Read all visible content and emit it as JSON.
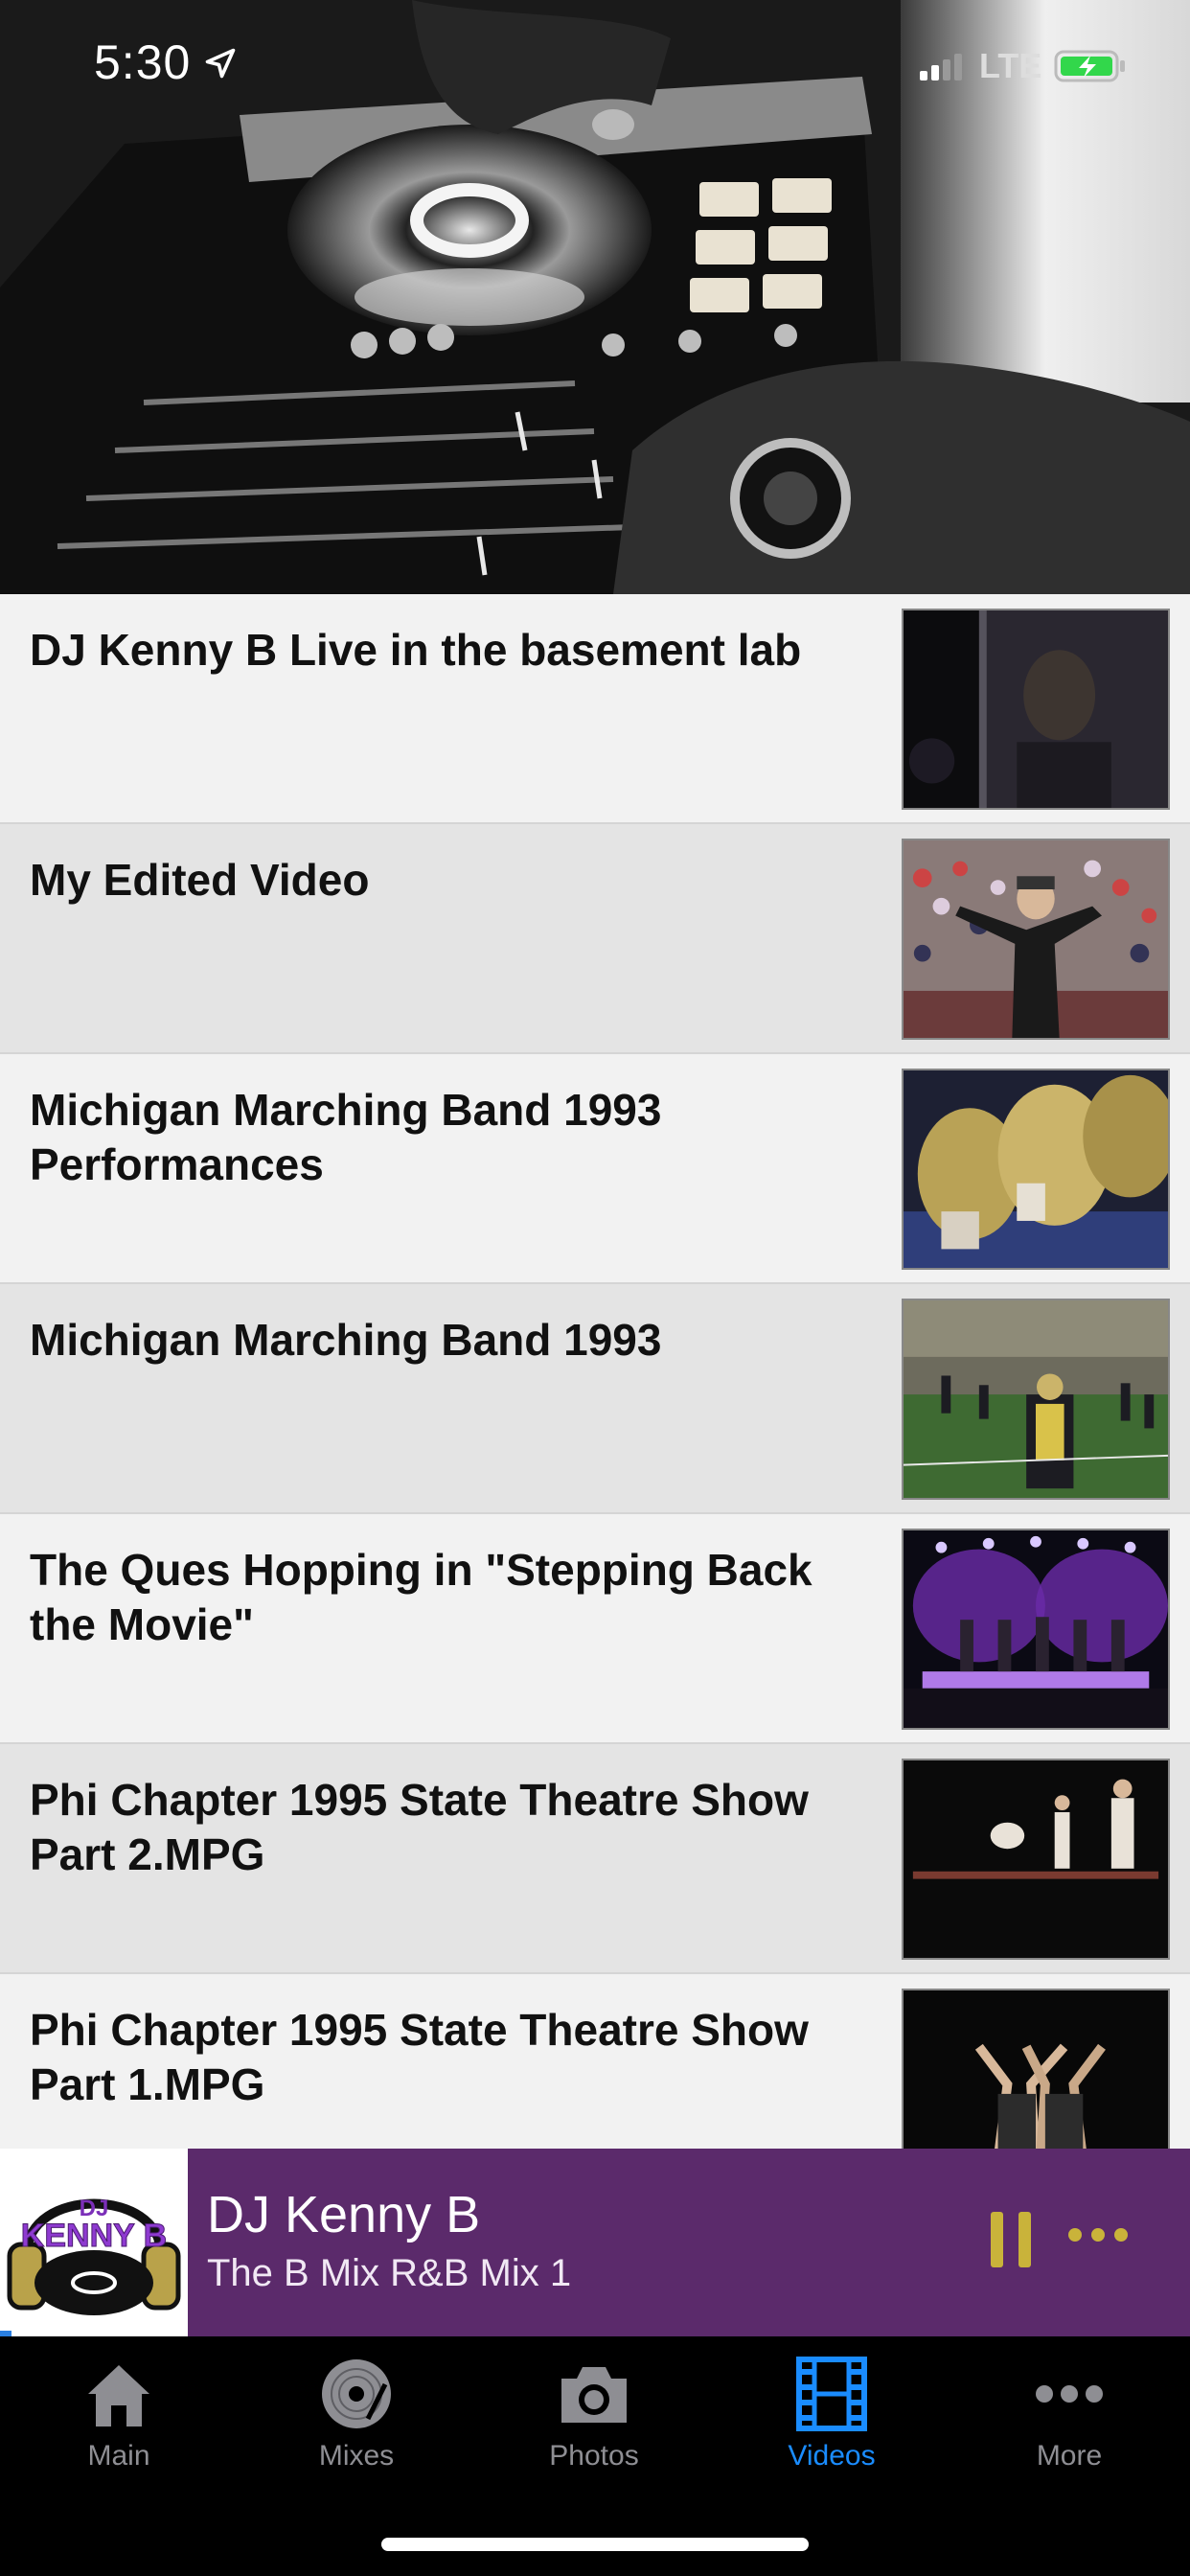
{
  "status_bar": {
    "time": "5:30",
    "network": "LTE",
    "battery_color": "#32d74b"
  },
  "hero": {
    "image": "dj-turntable-controller-photo"
  },
  "videos": [
    {
      "title": "DJ Kenny B Live in the basement lab",
      "thumb": "dark-portrait-webcam"
    },
    {
      "title": "My Edited Video",
      "thumb": "man-in-crowd-stadium"
    },
    {
      "title": "Michigan Marching Band 1993 Performances",
      "thumb": "cymbals-players"
    },
    {
      "title": "Michigan Marching Band 1993",
      "thumb": "band-on-field"
    },
    {
      "title": "The Ques Hopping in \"Stepping Back the Movie\"",
      "thumb": "purple-stage-steppers"
    },
    {
      "title": "Phi Chapter 1995 State Theatre Show Part 2.MPG",
      "thumb": "dark-stage-dancers"
    },
    {
      "title": "Phi Chapter 1995 State Theatre Show Part 1.MPG",
      "thumb": "dark-stage-arms-raised"
    }
  ],
  "player": {
    "artwork_logo": "DJ KENNY B",
    "artist": "DJ Kenny B",
    "track": "The B Mix R&B Mix 1",
    "accent_color": "#5b2a6b",
    "control_color": "#c9b33a"
  },
  "tabs": [
    {
      "label": "Main",
      "icon": "home-icon",
      "active": false
    },
    {
      "label": "Mixes",
      "icon": "vinyl-record-icon",
      "active": false
    },
    {
      "label": "Photos",
      "icon": "camera-icon",
      "active": false
    },
    {
      "label": "Videos",
      "icon": "film-strip-icon",
      "active": true
    },
    {
      "label": "More",
      "icon": "more-dots-icon",
      "active": false
    }
  ],
  "colors": {
    "active_tab": "#1a8cff",
    "inactive_tab": "#8e8e93"
  }
}
